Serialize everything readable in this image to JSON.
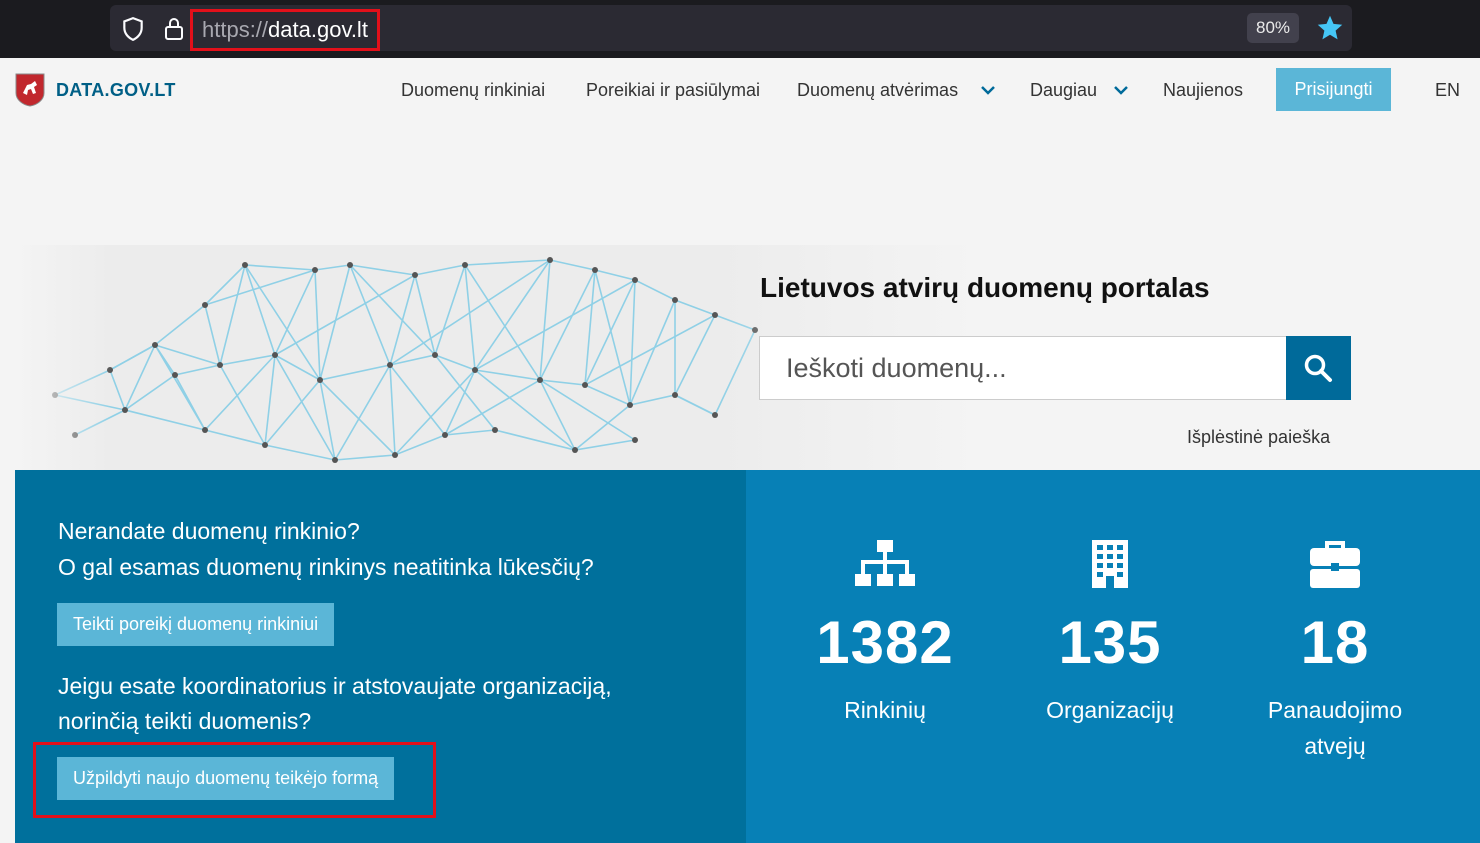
{
  "browser": {
    "url_scheme": "https://",
    "url_host": "data.gov.lt",
    "zoom": "80%",
    "icons": [
      "shield-icon",
      "lock-icon",
      "bookmark-star-icon"
    ]
  },
  "header": {
    "site_name": "DATA.GOV.LT",
    "nav": {
      "datasets": "Duomenų rinkiniai",
      "requests": "Poreikiai ir pasiūlymai",
      "opening": "Duomenų atvėrimas",
      "more": "Daugiau",
      "news": "Naujienos"
    },
    "login": "Prisijungti",
    "lang": "EN"
  },
  "hero": {
    "title": "Lietuvos atvirų duomenų portalas",
    "search_placeholder": "Ieškoti duomenų...",
    "advanced_search": "Išplėstinė paieška"
  },
  "cta": {
    "line1": "Nerandate duomenų rinkinio?",
    "line2": "O gal esamas duomenų rinkinys neatitinka lūkesčių?",
    "request_button": "Teikti poreikį duomenų rinkiniui",
    "line3": "Jeigu esate koordinatorius ir atstovaujate organizaciją,",
    "line4": "norinčią teikti duomenis?",
    "provider_button": "Užpildyti naujo duomenų teikėjo formą"
  },
  "stats": {
    "datasets": {
      "value": "1382",
      "label": "Rinkinių",
      "icon": "sitemap-icon"
    },
    "orgs": {
      "value": "135",
      "label": "Organizacijų",
      "icon": "building-icon"
    },
    "usecases": {
      "value": "18",
      "label_line1": "Panaudojimo",
      "label_line2": "atvejų",
      "icon": "briefcase-icon"
    }
  },
  "colors": {
    "brand": "#005f86",
    "panel_dark": "#00709c",
    "panel_light": "#0780b6",
    "button": "#5bb6d7",
    "highlight": "#e3101a"
  }
}
